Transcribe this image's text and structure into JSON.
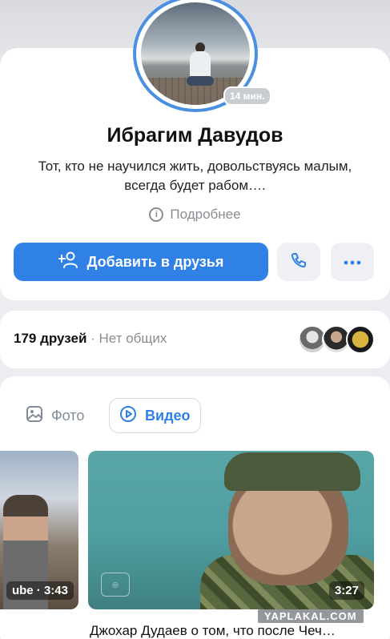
{
  "profile": {
    "name": "Ибрагим Давудов",
    "status": "Тот, кто не научился жить, довольствуясь малым, всегда будет рабом….",
    "online_badge": "14 мин.",
    "more_label": "Подробнее"
  },
  "actions": {
    "add_friend_label": "Добавить в друзья",
    "icons": [
      "add-user-icon",
      "phone-icon",
      "more-icon"
    ],
    "accent": "#2f81e5"
  },
  "friends": {
    "count_label": "179 друзей",
    "mutual_label": "· Нет общих"
  },
  "media_tabs": [
    {
      "label": "Фото",
      "icon": "photo-icon",
      "active": false
    },
    {
      "label": "Видео",
      "icon": "play-icon",
      "active": true
    }
  ],
  "videos": [
    {
      "duration": "ube · 3:43"
    },
    {
      "duration": "3:27",
      "title": "Джохар Дудаев о том, что после Чеч…"
    }
  ],
  "watermark": "YAPLAKAL.COM"
}
